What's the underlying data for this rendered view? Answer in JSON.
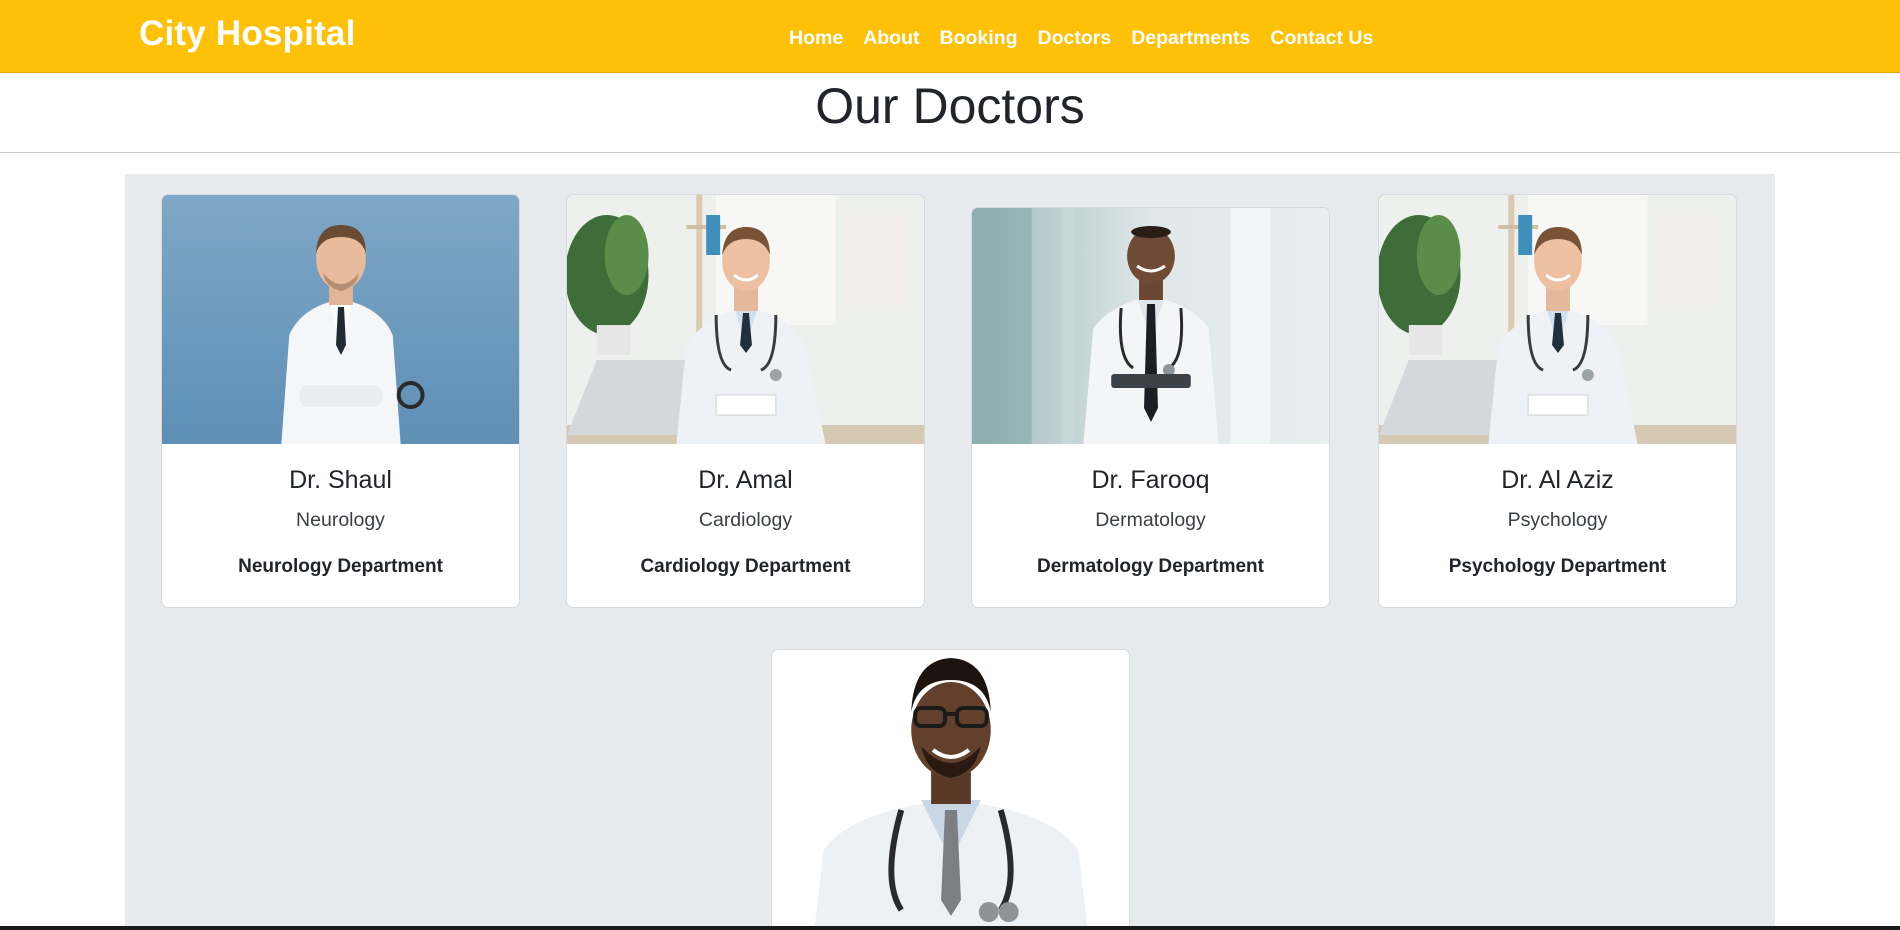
{
  "navbar": {
    "brand": "City Hospital",
    "links": [
      "Home",
      "About",
      "Booking",
      "Doctors",
      "Departments",
      "Contact Us"
    ]
  },
  "page": {
    "title": "Our Doctors"
  },
  "doctors": [
    {
      "name": "Dr. Shaul",
      "specialty": "Neurology",
      "department": "Neurology Department"
    },
    {
      "name": "Dr. Amal",
      "specialty": "Cardiology",
      "department": "Cardiology Department"
    },
    {
      "name": "Dr. Farooq",
      "specialty": "Dermatology",
      "department": "Dermatology Department"
    },
    {
      "name": "Dr. Al Aziz",
      "specialty": "Psychology",
      "department": "Psychology Department"
    },
    {
      "name": "",
      "specialty": "",
      "department": ""
    }
  ],
  "colors": {
    "navbar_bg": "#ffc107",
    "panel_bg": "#e8ebee",
    "text": "#212529"
  }
}
